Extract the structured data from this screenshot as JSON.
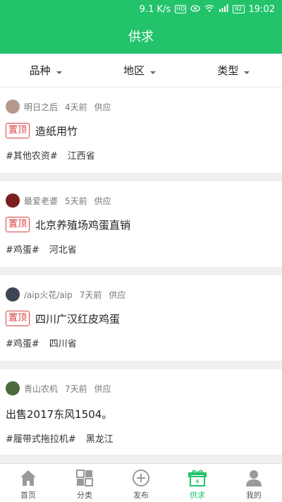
{
  "status_bar": {
    "speed": "9.1 K/s",
    "hd": "HD",
    "battery": "82",
    "time": "19:02"
  },
  "header": {
    "title": "供求"
  },
  "filters": [
    {
      "label": "品种"
    },
    {
      "label": "地区"
    },
    {
      "label": "类型"
    }
  ],
  "posts": [
    {
      "user": "明日之后",
      "time": "4天前",
      "type": "供应",
      "pinned": true,
      "pin_label": "置顶",
      "title": "造纸用竹",
      "tag": "#其他农资#",
      "region": "江西省",
      "avatar_color": "#b59a8b"
    },
    {
      "user": "最爱老婆",
      "time": "5天前",
      "type": "供应",
      "pinned": true,
      "pin_label": "置顶",
      "title": "北京养殖场鸡蛋直销",
      "tag": "#鸡蛋#",
      "region": "河北省",
      "avatar_color": "#7a1f1f"
    },
    {
      "user": "/aip火花/aip",
      "time": "7天前",
      "type": "供应",
      "pinned": true,
      "pin_label": "置顶",
      "title": "四川广汉红皮鸡蛋",
      "tag": "#鸡蛋#",
      "region": "四川省",
      "avatar_color": "#3c4454"
    },
    {
      "user": "青山农机",
      "time": "7天前",
      "type": "供应",
      "pinned": false,
      "pin_label": "",
      "title": "出售2017东风1504。",
      "tag": "#履带式拖拉机#",
      "region": "黑龙江",
      "avatar_color": "#4b6b3a"
    }
  ],
  "tabbar": [
    {
      "label": "首页",
      "icon": "home-icon"
    },
    {
      "label": "分类",
      "icon": "grid-icon"
    },
    {
      "label": "发布",
      "icon": "plus-circle-icon"
    },
    {
      "label": "供求",
      "icon": "gift-yen-icon"
    },
    {
      "label": "我的",
      "icon": "person-icon"
    }
  ],
  "colors": {
    "brand": "#22c36b",
    "pin": "#d94040"
  }
}
